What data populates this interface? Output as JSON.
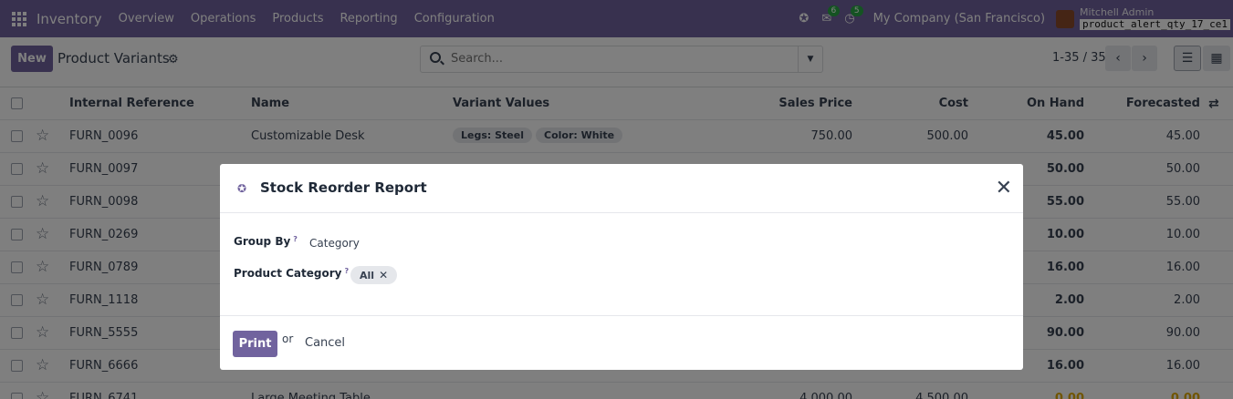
{
  "navbar": {
    "app_name": "Inventory",
    "menus": [
      "Overview",
      "Operations",
      "Products",
      "Reporting",
      "Configuration"
    ],
    "messages_count": "6",
    "activities_count": "5",
    "company": "My Company (San Francisco)",
    "user_name": "Mitchell Admin",
    "db_name": "product_alert_qty_17_ce1",
    "bug_icon": "bug-icon"
  },
  "control": {
    "new_label": "New",
    "title": "Product Variants",
    "search_placeholder": "Search...",
    "pager": "1-35 / 35"
  },
  "table": {
    "headers": {
      "ref": "Internal Reference",
      "name": "Name",
      "variants": "Variant Values",
      "price": "Sales Price",
      "cost": "Cost",
      "onhand": "On Hand",
      "forecast": "Forecasted"
    },
    "rows": [
      {
        "ref": "FURN_0096",
        "name": "Customizable Desk",
        "tag1": "Legs: Steel",
        "tag2": "Color: White",
        "price": "750.00",
        "cost": "500.00",
        "onhand": "45.00",
        "forecast": "45.00"
      },
      {
        "ref": "FURN_0097",
        "onhand": "50.00",
        "forecast": "50.00"
      },
      {
        "ref": "FURN_0098",
        "onhand": "55.00",
        "forecast": "55.00"
      },
      {
        "ref": "FURN_0269",
        "onhand": "10.00",
        "forecast": "10.00"
      },
      {
        "ref": "FURN_0789",
        "onhand": "16.00",
        "forecast": "16.00"
      },
      {
        "ref": "FURN_1118",
        "onhand": "2.00",
        "forecast": "2.00"
      },
      {
        "ref": "FURN_5555",
        "onhand": "90.00",
        "forecast": "90.00"
      },
      {
        "ref": "FURN_6666",
        "onhand": "16.00",
        "forecast": "16.00"
      },
      {
        "ref": "FURN_6741",
        "name": "Large Meeting Table",
        "price": "4,000.00",
        "cost": "4,500.00",
        "onhand": "0.00",
        "forecast": "0.00"
      }
    ]
  },
  "modal": {
    "title": "Stock Reorder Report",
    "group_by_label": "Group By",
    "group_by_value": "Category",
    "category_label": "Product Category",
    "category_tag": "All",
    "help_mark": "?",
    "print_label": "Print",
    "or_text": "or",
    "cancel_label": "Cancel"
  }
}
